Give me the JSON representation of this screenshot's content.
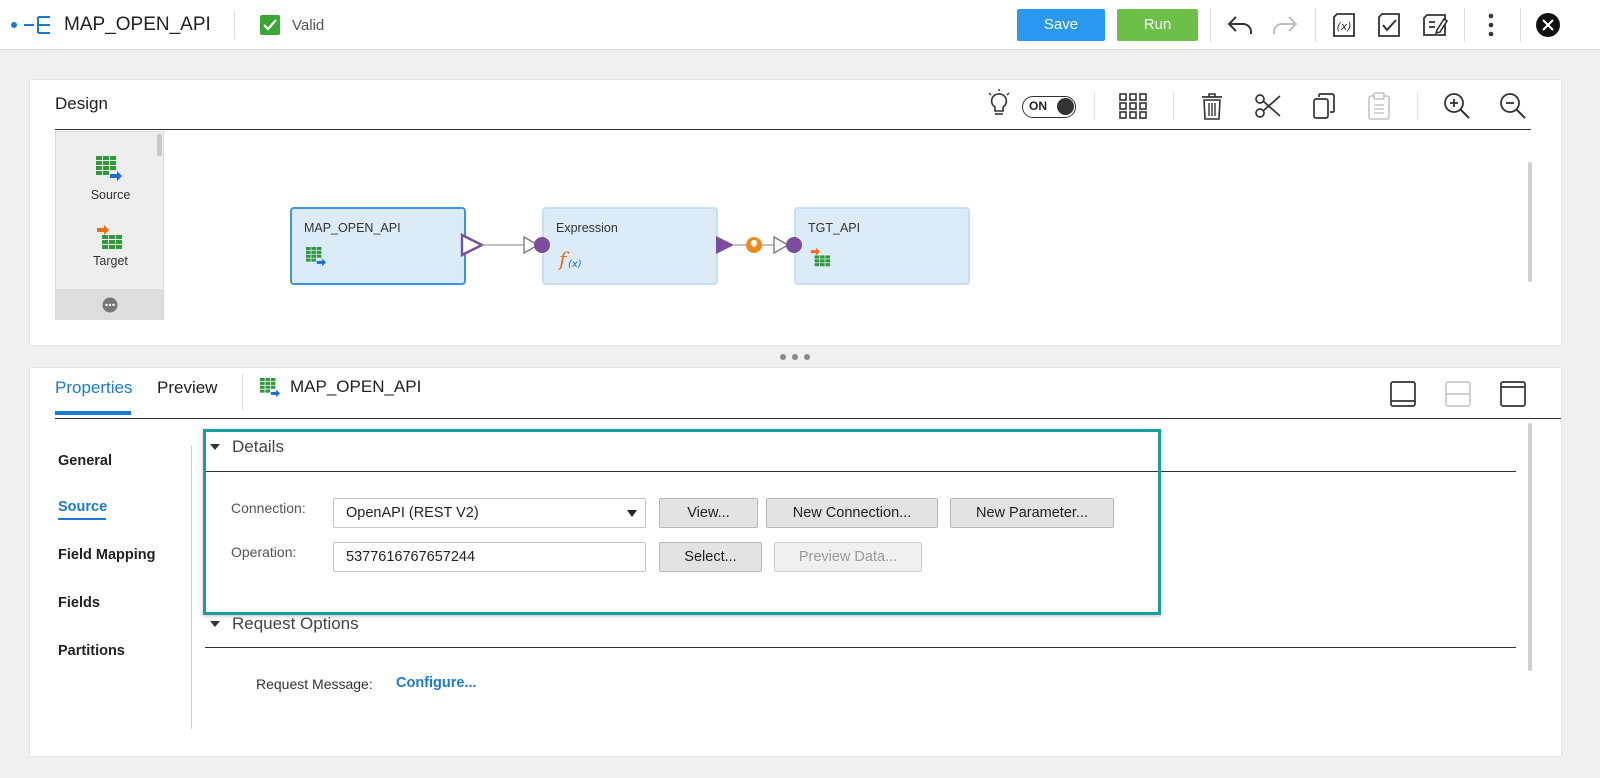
{
  "header": {
    "title": "MAP_OPEN_API",
    "status": "Valid",
    "save_label": "Save",
    "run_label": "Run"
  },
  "design": {
    "title": "Design",
    "toggle_label": "ON",
    "palette": [
      {
        "label": "Source"
      },
      {
        "label": "Target"
      }
    ],
    "nodes": [
      {
        "label": "MAP_OPEN_API"
      },
      {
        "label": "Expression"
      },
      {
        "label": "TGT_API"
      }
    ]
  },
  "properties": {
    "tabs": [
      "Properties",
      "Preview"
    ],
    "object_name": "MAP_OPEN_API",
    "side_nav": [
      "General",
      "Source",
      "Field Mapping",
      "Fields",
      "Partitions"
    ],
    "details": {
      "title": "Details",
      "connection_label": "Connection:",
      "connection_value": "OpenAPI (REST V2)",
      "view_label": "View...",
      "new_connection_label": "New Connection...",
      "new_parameter_label": "New Parameter...",
      "operation_label": "Operation:",
      "operation_value": "5377616767657244",
      "select_label": "Select...",
      "preview_data_label": "Preview Data..."
    },
    "request_options": {
      "title": "Request Options",
      "request_message_label": "Request Message:",
      "configure_label": "Configure..."
    }
  },
  "colors": {
    "accent_blue": "#1a7ad4",
    "run_green": "#6cc04a",
    "save_blue": "#2a98f0",
    "highlight_teal": "#1a9e9a"
  }
}
